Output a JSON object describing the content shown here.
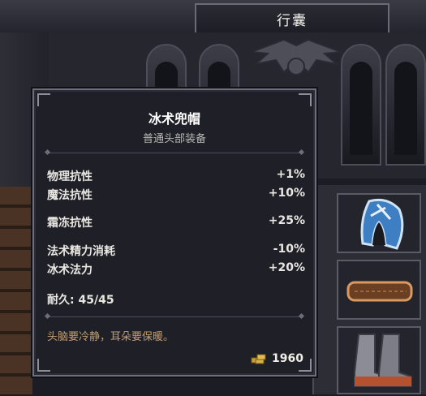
{
  "header": {
    "title": "行囊"
  },
  "tooltip": {
    "item_name": "冰术兜帽",
    "item_type": "普通头部装备",
    "stats": [
      {
        "label": "物理抗性",
        "value": "+1%"
      },
      {
        "label": "魔法抗性",
        "value": "+10%"
      },
      {
        "label": "霜冻抗性",
        "value": "+25%"
      },
      {
        "label": "法术精力消耗",
        "value": "-10%"
      },
      {
        "label": "冰术法力",
        "value": "+20%"
      }
    ],
    "durability_label": "耐久:",
    "durability_value": "45/45",
    "flavor_text": "头脑要冷静，耳朵要保暖。",
    "price": "1960",
    "price_icon": "gold-coins-icon"
  },
  "inventory": {
    "items": [
      "ice-hood-icon",
      "leather-belt-icon",
      "boots-icon"
    ]
  },
  "colors": {
    "tooltip_bg": "#1e1f27",
    "flavor": "#c79d72",
    "hood_blue": "#3e7fc4"
  }
}
